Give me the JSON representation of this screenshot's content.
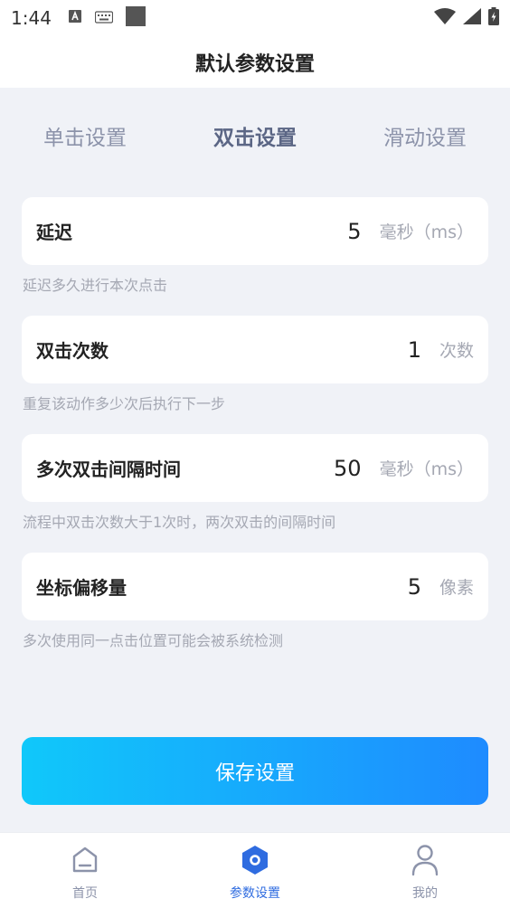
{
  "status_bar": {
    "time": "1:44"
  },
  "header": {
    "title": "默认参数设置"
  },
  "tabs": [
    {
      "label": "单击设置",
      "active": false
    },
    {
      "label": "双击设置",
      "active": true
    },
    {
      "label": "滑动设置",
      "active": false
    }
  ],
  "settings": [
    {
      "label": "延迟",
      "value": "5",
      "unit": "毫秒（ms）",
      "hint": "延迟多久进行本次点击"
    },
    {
      "label": "双击次数",
      "value": "1",
      "unit": "次数",
      "hint": "重复该动作多少次后执行下一步"
    },
    {
      "label": "多次双击间隔时间",
      "value": "50",
      "unit": "毫秒（ms）",
      "hint": "流程中双击次数大于1次时，两次双击的间隔时间"
    },
    {
      "label": "坐标偏移量",
      "value": "5",
      "unit": "像素",
      "hint": "多次使用同一点击位置可能会被系统检测"
    }
  ],
  "save_button": {
    "label": "保存设置"
  },
  "bottom_nav": [
    {
      "label": "首页",
      "icon": "home-icon",
      "active": false
    },
    {
      "label": "参数设置",
      "icon": "settings-hexagon-icon",
      "active": true
    },
    {
      "label": "我的",
      "icon": "user-icon",
      "active": false
    }
  ],
  "colors": {
    "accent": "#2f6ce0",
    "button_gradient_start": "#10c8fa",
    "button_gradient_end": "#1e8bff",
    "background": "#f0f2f7"
  }
}
